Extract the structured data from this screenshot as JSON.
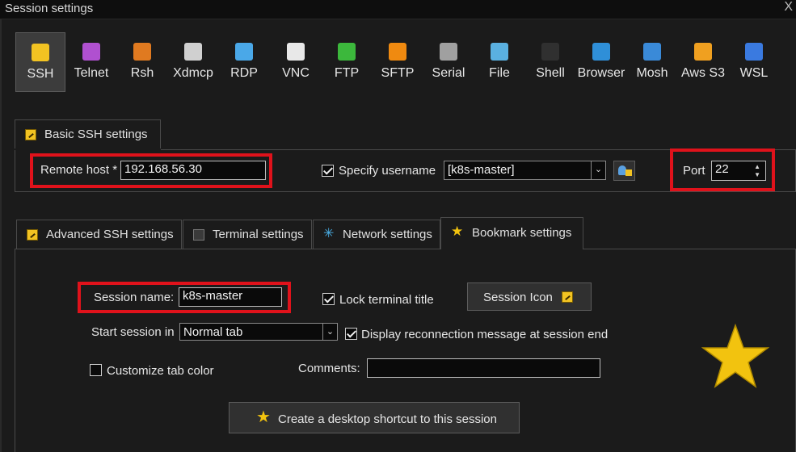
{
  "window": {
    "title": "Session settings",
    "close_glyph": "X"
  },
  "protocols": [
    {
      "label": "SSH",
      "icon": "ssh-key-icon",
      "color": "#f2c322",
      "selected": true
    },
    {
      "label": "Telnet",
      "icon": "telnet-icon",
      "color": "#b050d0"
    },
    {
      "label": "Rsh",
      "icon": "rsh-icon",
      "color": "#e07a20"
    },
    {
      "label": "Xdmcp",
      "icon": "x-logo-icon",
      "color": "#d0d0d0"
    },
    {
      "label": "RDP",
      "icon": "monitor-icon",
      "color": "#4aa8e8"
    },
    {
      "label": "VNC",
      "icon": "vnc-icon",
      "color": "#e8e8e8"
    },
    {
      "label": "FTP",
      "icon": "globe-green-icon",
      "color": "#3cb83c"
    },
    {
      "label": "SFTP",
      "icon": "globe-orange-icon",
      "color": "#f08a10"
    },
    {
      "label": "Serial",
      "icon": "plug-icon",
      "color": "#a0a0a0"
    },
    {
      "label": "File",
      "icon": "monitor-file-icon",
      "color": "#5ab0e0"
    },
    {
      "label": "Shell",
      "icon": "terminal-icon",
      "color": "#303030"
    },
    {
      "label": "Browser",
      "icon": "globe-blue-icon",
      "color": "#2f8fd8"
    },
    {
      "label": "Mosh",
      "icon": "satellite-icon",
      "color": "#3a8ad8"
    },
    {
      "label": "Aws S3",
      "icon": "boxes-icon",
      "color": "#f0a020"
    },
    {
      "label": "WSL",
      "icon": "windows-icon",
      "color": "#3a7ae0"
    }
  ],
  "basic": {
    "tab_label": "Basic SSH settings",
    "remote_host_label": "Remote host *",
    "remote_host_value": "192.168.56.30",
    "specify_username_label": "Specify username",
    "username_value": "[k8s-master]",
    "port_label": "Port",
    "port_value": "22"
  },
  "tabs": [
    {
      "label": "Advanced SSH settings",
      "icon": "key-icon"
    },
    {
      "label": "Terminal settings",
      "icon": "terminal-settings-icon"
    },
    {
      "label": "Network settings",
      "icon": "network-star-icon"
    },
    {
      "label": "Bookmark settings",
      "icon": "star-icon",
      "active": true
    }
  ],
  "bookmark": {
    "session_name_label": "Session name:",
    "session_name_value": "k8s-master",
    "lock_title_label": "Lock terminal title",
    "session_icon_label": "Session Icon",
    "start_in_label": "Start session in",
    "start_in_value": "Normal tab",
    "display_reconnect_label": "Display reconnection message at session end",
    "customize_color_label": "Customize tab color",
    "comments_label": "Comments:",
    "comments_value": "",
    "shortcut_label": "Create a desktop shortcut to this session"
  },
  "colors": {
    "accent_red": "#e0121b",
    "star": "#f2c30f",
    "background": "#1b1b1b"
  }
}
